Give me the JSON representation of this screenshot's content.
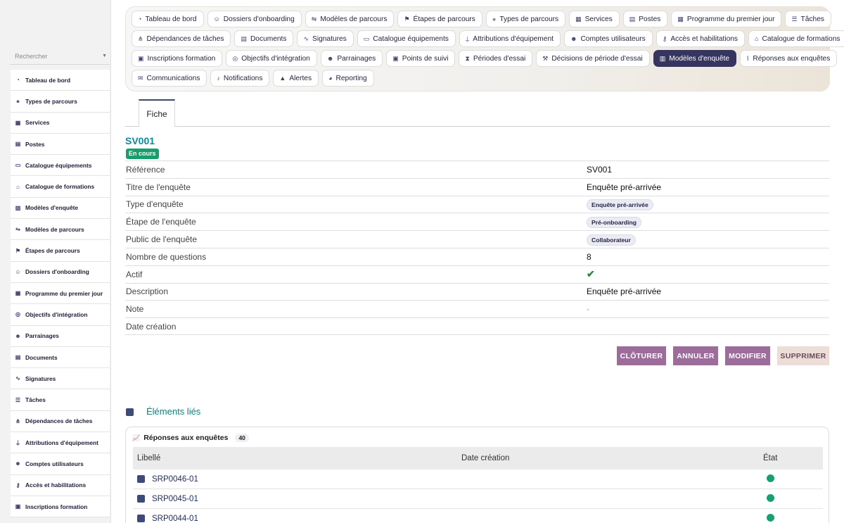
{
  "sidebar": {
    "search_placeholder": "Rechercher",
    "items": [
      {
        "label": "Tableau de bord",
        "icon": "dashboard-icon"
      },
      {
        "label": "Types de parcours",
        "icon": "sitemap-icon"
      },
      {
        "label": "Services",
        "icon": "building-icon"
      },
      {
        "label": "Postes",
        "icon": "id-badge-icon"
      },
      {
        "label": "Catalogue équipements",
        "icon": "laptop-icon"
      },
      {
        "label": "Catalogue de formations",
        "icon": "graduation-cap-icon"
      },
      {
        "label": "Modèles d'enquête",
        "icon": "clipboard-icon"
      },
      {
        "label": "Modèles de parcours",
        "icon": "signpost-icon"
      },
      {
        "label": "Étapes de parcours",
        "icon": "flag-icon"
      },
      {
        "label": "Dossiers d'onboarding",
        "icon": "user-plus-icon"
      },
      {
        "label": "Programme du premier jour",
        "icon": "calendar-icon"
      },
      {
        "label": "Objectifs d'intégration",
        "icon": "target-icon"
      },
      {
        "label": "Parrainages",
        "icon": "users-icon"
      },
      {
        "label": "Documents",
        "icon": "file-icon"
      },
      {
        "label": "Signatures",
        "icon": "signature-icon"
      },
      {
        "label": "Tâches",
        "icon": "list-icon"
      },
      {
        "label": "Dépendances de tâches",
        "icon": "diagram-icon"
      },
      {
        "label": "Attributions d'équipement",
        "icon": "dolly-icon"
      },
      {
        "label": "Comptes utilisateurs",
        "icon": "user-gear-icon"
      },
      {
        "label": "Accès et habilitations",
        "icon": "key-icon"
      },
      {
        "label": "Inscriptions formation",
        "icon": "user-check-icon"
      }
    ]
  },
  "nav": {
    "rows": [
      [
        {
          "label": "Tableau de bord",
          "icon": "dashboard-icon"
        },
        {
          "label": "Dossiers d'onboarding",
          "icon": "user-plus-icon"
        },
        {
          "label": "Modèles de parcours",
          "icon": "signpost-icon"
        },
        {
          "label": "Étapes de parcours",
          "icon": "flag-icon"
        },
        {
          "label": "Types de parcours",
          "icon": "sitemap-icon"
        },
        {
          "label": "Services",
          "icon": "building-icon"
        },
        {
          "label": "Postes",
          "icon": "id-badge-icon"
        },
        {
          "label": "Programme du premier jour",
          "icon": "calendar-icon"
        },
        {
          "label": "Tâches",
          "icon": "list-icon"
        }
      ],
      [
        {
          "label": "Dépendances de tâches",
          "icon": "diagram-icon"
        },
        {
          "label": "Documents",
          "icon": "file-icon"
        },
        {
          "label": "Signatures",
          "icon": "signature-icon"
        },
        {
          "label": "Catalogue équipements",
          "icon": "laptop-icon"
        },
        {
          "label": "Attributions d'équipement",
          "icon": "dolly-icon"
        },
        {
          "label": "Comptes utilisateurs",
          "icon": "user-gear-icon"
        },
        {
          "label": "Accès et habilitations",
          "icon": "key-icon"
        },
        {
          "label": "Catalogue de formations",
          "icon": "graduation-cap-icon"
        }
      ],
      [
        {
          "label": "Inscriptions formation",
          "icon": "user-check-icon"
        },
        {
          "label": "Objectifs d'intégration",
          "icon": "target-icon"
        },
        {
          "label": "Parrainages",
          "icon": "users-icon"
        },
        {
          "label": "Points de suivi",
          "icon": "clipboard-check-icon"
        },
        {
          "label": "Périodes d'essai",
          "icon": "hourglass-icon"
        },
        {
          "label": "Décisions de période d'essai",
          "icon": "gavel-icon"
        },
        {
          "label": "Modèles d'enquête",
          "icon": "clipboard-icon",
          "active": true
        },
        {
          "label": "Réponses aux enquêtes",
          "icon": "chart-line-icon"
        }
      ],
      [
        {
          "label": "Communications",
          "icon": "envelope-icon"
        },
        {
          "label": "Notifications",
          "icon": "bell-icon"
        },
        {
          "label": "Alertes",
          "icon": "warning-icon"
        },
        {
          "label": "Reporting",
          "icon": "pie-chart-icon"
        }
      ]
    ]
  },
  "tabs": {
    "fiche": "Fiche"
  },
  "record": {
    "code": "SV001",
    "status": "En cours",
    "fields": [
      {
        "label": "Référence",
        "value": "SV001",
        "kind": "text"
      },
      {
        "label": "Titre de l'enquête",
        "value": "Enquête pré-arrivée",
        "kind": "text"
      },
      {
        "label": "Type d'enquête",
        "value": "Enquête pré-arrivée",
        "kind": "pill"
      },
      {
        "label": "Étape de l'enquête",
        "value": "Pré-onboarding",
        "kind": "pill"
      },
      {
        "label": "Public de l'enquête",
        "value": "Collaborateur",
        "kind": "pill"
      },
      {
        "label": "Nombre de questions",
        "value": "8",
        "kind": "text"
      },
      {
        "label": "Actif",
        "value": "✔",
        "kind": "check"
      },
      {
        "label": "Description",
        "value": "Enquête pré-arrivée",
        "kind": "text"
      },
      {
        "label": "Note",
        "value": "-",
        "kind": "dash"
      },
      {
        "label": "Date création",
        "value": "",
        "kind": "text"
      }
    ]
  },
  "actions": {
    "cloturer": "CLÔTURER",
    "annuler": "ANNULER",
    "modifier": "MODIFIER",
    "supprimer": "SUPPRIMER"
  },
  "linked": {
    "title": "Éléments liés",
    "card_title": "Réponses aux enquêtes",
    "count": "40",
    "columns": [
      "Libellé",
      "Date création",
      "État"
    ],
    "rows": [
      {
        "label": "SRP0046-01",
        "date": "",
        "status_color": "#1aa070"
      },
      {
        "label": "SRP0045-01",
        "date": "",
        "status_color": "#1aa070"
      },
      {
        "label": "SRP0044-01",
        "date": "",
        "status_color": "#1aa070"
      }
    ]
  },
  "colors": {
    "accent": "#363560",
    "title": "#0c8a9a",
    "badge": "#189e6c",
    "action": "#9c6c9b"
  }
}
